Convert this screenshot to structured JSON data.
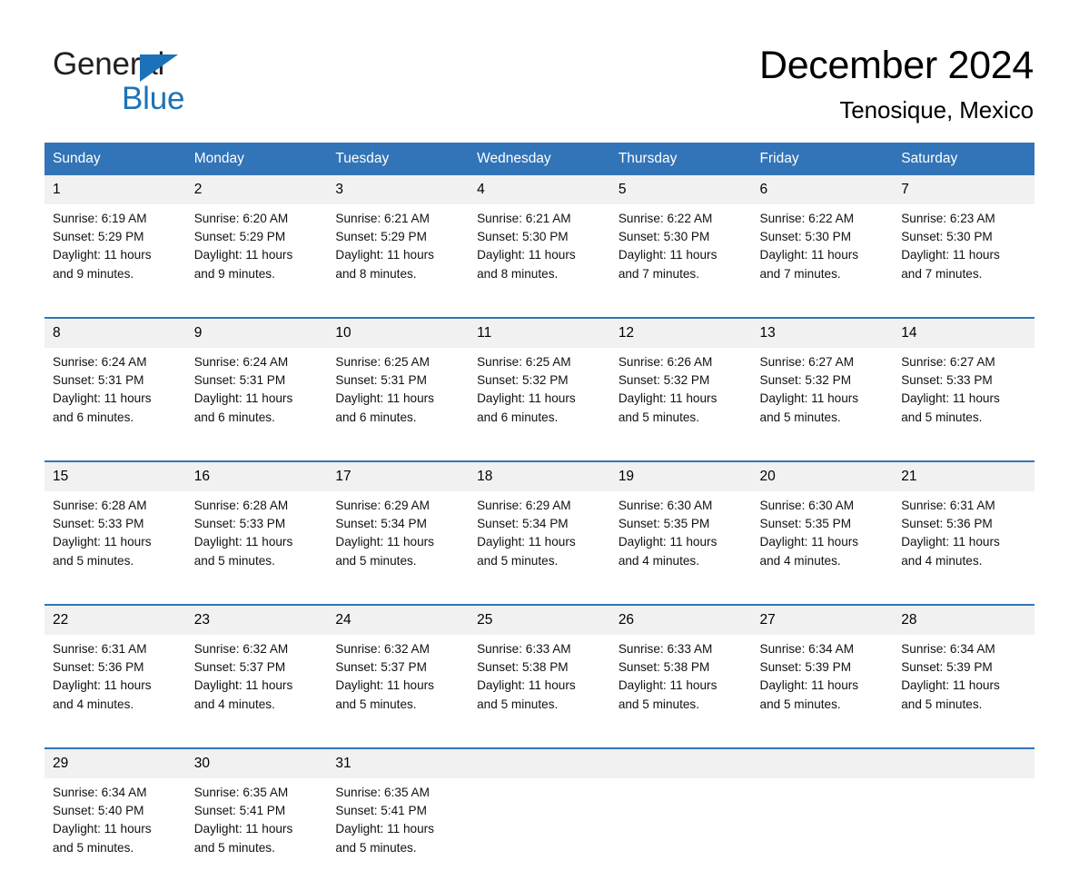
{
  "brand": {
    "name_part1": "General",
    "name_part2": "Blue",
    "logo_icon": "triangle-logo-icon",
    "accent_color": "#1b72b8"
  },
  "header": {
    "title": "December 2024",
    "subtitle": "Tenosique, Mexico"
  },
  "theme": {
    "header_blue": "#3174b8",
    "day_band_gray": "#f1f1f1",
    "rule_blue": "#3174b8",
    "text_black": "#000000"
  },
  "weekday_headers": [
    "Sunday",
    "Monday",
    "Tuesday",
    "Wednesday",
    "Thursday",
    "Friday",
    "Saturday"
  ],
  "weeks": [
    {
      "days": [
        {
          "day": "1",
          "sunrise": "Sunrise: 6:19 AM",
          "sunset": "Sunset: 5:29 PM",
          "daylight_line1": "Daylight: 11 hours",
          "daylight_line2": "and 9 minutes."
        },
        {
          "day": "2",
          "sunrise": "Sunrise: 6:20 AM",
          "sunset": "Sunset: 5:29 PM",
          "daylight_line1": "Daylight: 11 hours",
          "daylight_line2": "and 9 minutes."
        },
        {
          "day": "3",
          "sunrise": "Sunrise: 6:21 AM",
          "sunset": "Sunset: 5:29 PM",
          "daylight_line1": "Daylight: 11 hours",
          "daylight_line2": "and 8 minutes."
        },
        {
          "day": "4",
          "sunrise": "Sunrise: 6:21 AM",
          "sunset": "Sunset: 5:30 PM",
          "daylight_line1": "Daylight: 11 hours",
          "daylight_line2": "and 8 minutes."
        },
        {
          "day": "5",
          "sunrise": "Sunrise: 6:22 AM",
          "sunset": "Sunset: 5:30 PM",
          "daylight_line1": "Daylight: 11 hours",
          "daylight_line2": "and 7 minutes."
        },
        {
          "day": "6",
          "sunrise": "Sunrise: 6:22 AM",
          "sunset": "Sunset: 5:30 PM",
          "daylight_line1": "Daylight: 11 hours",
          "daylight_line2": "and 7 minutes."
        },
        {
          "day": "7",
          "sunrise": "Sunrise: 6:23 AM",
          "sunset": "Sunset: 5:30 PM",
          "daylight_line1": "Daylight: 11 hours",
          "daylight_line2": "and 7 minutes."
        }
      ]
    },
    {
      "days": [
        {
          "day": "8",
          "sunrise": "Sunrise: 6:24 AM",
          "sunset": "Sunset: 5:31 PM",
          "daylight_line1": "Daylight: 11 hours",
          "daylight_line2": "and 6 minutes."
        },
        {
          "day": "9",
          "sunrise": "Sunrise: 6:24 AM",
          "sunset": "Sunset: 5:31 PM",
          "daylight_line1": "Daylight: 11 hours",
          "daylight_line2": "and 6 minutes."
        },
        {
          "day": "10",
          "sunrise": "Sunrise: 6:25 AM",
          "sunset": "Sunset: 5:31 PM",
          "daylight_line1": "Daylight: 11 hours",
          "daylight_line2": "and 6 minutes."
        },
        {
          "day": "11",
          "sunrise": "Sunrise: 6:25 AM",
          "sunset": "Sunset: 5:32 PM",
          "daylight_line1": "Daylight: 11 hours",
          "daylight_line2": "and 6 minutes."
        },
        {
          "day": "12",
          "sunrise": "Sunrise: 6:26 AM",
          "sunset": "Sunset: 5:32 PM",
          "daylight_line1": "Daylight: 11 hours",
          "daylight_line2": "and 5 minutes."
        },
        {
          "day": "13",
          "sunrise": "Sunrise: 6:27 AM",
          "sunset": "Sunset: 5:32 PM",
          "daylight_line1": "Daylight: 11 hours",
          "daylight_line2": "and 5 minutes."
        },
        {
          "day": "14",
          "sunrise": "Sunrise: 6:27 AM",
          "sunset": "Sunset: 5:33 PM",
          "daylight_line1": "Daylight: 11 hours",
          "daylight_line2": "and 5 minutes."
        }
      ]
    },
    {
      "days": [
        {
          "day": "15",
          "sunrise": "Sunrise: 6:28 AM",
          "sunset": "Sunset: 5:33 PM",
          "daylight_line1": "Daylight: 11 hours",
          "daylight_line2": "and 5 minutes."
        },
        {
          "day": "16",
          "sunrise": "Sunrise: 6:28 AM",
          "sunset": "Sunset: 5:33 PM",
          "daylight_line1": "Daylight: 11 hours",
          "daylight_line2": "and 5 minutes."
        },
        {
          "day": "17",
          "sunrise": "Sunrise: 6:29 AM",
          "sunset": "Sunset: 5:34 PM",
          "daylight_line1": "Daylight: 11 hours",
          "daylight_line2": "and 5 minutes."
        },
        {
          "day": "18",
          "sunrise": "Sunrise: 6:29 AM",
          "sunset": "Sunset: 5:34 PM",
          "daylight_line1": "Daylight: 11 hours",
          "daylight_line2": "and 5 minutes."
        },
        {
          "day": "19",
          "sunrise": "Sunrise: 6:30 AM",
          "sunset": "Sunset: 5:35 PM",
          "daylight_line1": "Daylight: 11 hours",
          "daylight_line2": "and 4 minutes."
        },
        {
          "day": "20",
          "sunrise": "Sunrise: 6:30 AM",
          "sunset": "Sunset: 5:35 PM",
          "daylight_line1": "Daylight: 11 hours",
          "daylight_line2": "and 4 minutes."
        },
        {
          "day": "21",
          "sunrise": "Sunrise: 6:31 AM",
          "sunset": "Sunset: 5:36 PM",
          "daylight_line1": "Daylight: 11 hours",
          "daylight_line2": "and 4 minutes."
        }
      ]
    },
    {
      "days": [
        {
          "day": "22",
          "sunrise": "Sunrise: 6:31 AM",
          "sunset": "Sunset: 5:36 PM",
          "daylight_line1": "Daylight: 11 hours",
          "daylight_line2": "and 4 minutes."
        },
        {
          "day": "23",
          "sunrise": "Sunrise: 6:32 AM",
          "sunset": "Sunset: 5:37 PM",
          "daylight_line1": "Daylight: 11 hours",
          "daylight_line2": "and 4 minutes."
        },
        {
          "day": "24",
          "sunrise": "Sunrise: 6:32 AM",
          "sunset": "Sunset: 5:37 PM",
          "daylight_line1": "Daylight: 11 hours",
          "daylight_line2": "and 5 minutes."
        },
        {
          "day": "25",
          "sunrise": "Sunrise: 6:33 AM",
          "sunset": "Sunset: 5:38 PM",
          "daylight_line1": "Daylight: 11 hours",
          "daylight_line2": "and 5 minutes."
        },
        {
          "day": "26",
          "sunrise": "Sunrise: 6:33 AM",
          "sunset": "Sunset: 5:38 PM",
          "daylight_line1": "Daylight: 11 hours",
          "daylight_line2": "and 5 minutes."
        },
        {
          "day": "27",
          "sunrise": "Sunrise: 6:34 AM",
          "sunset": "Sunset: 5:39 PM",
          "daylight_line1": "Daylight: 11 hours",
          "daylight_line2": "and 5 minutes."
        },
        {
          "day": "28",
          "sunrise": "Sunrise: 6:34 AM",
          "sunset": "Sunset: 5:39 PM",
          "daylight_line1": "Daylight: 11 hours",
          "daylight_line2": "and 5 minutes."
        }
      ]
    },
    {
      "days": [
        {
          "day": "29",
          "sunrise": "Sunrise: 6:34 AM",
          "sunset": "Sunset: 5:40 PM",
          "daylight_line1": "Daylight: 11 hours",
          "daylight_line2": "and 5 minutes."
        },
        {
          "day": "30",
          "sunrise": "Sunrise: 6:35 AM",
          "sunset": "Sunset: 5:41 PM",
          "daylight_line1": "Daylight: 11 hours",
          "daylight_line2": "and 5 minutes."
        },
        {
          "day": "31",
          "sunrise": "Sunrise: 6:35 AM",
          "sunset": "Sunset: 5:41 PM",
          "daylight_line1": "Daylight: 11 hours",
          "daylight_line2": "and 5 minutes."
        },
        {
          "day": "",
          "sunrise": "",
          "sunset": "",
          "daylight_line1": "",
          "daylight_line2": ""
        },
        {
          "day": "",
          "sunrise": "",
          "sunset": "",
          "daylight_line1": "",
          "daylight_line2": ""
        },
        {
          "day": "",
          "sunrise": "",
          "sunset": "",
          "daylight_line1": "",
          "daylight_line2": ""
        },
        {
          "day": "",
          "sunrise": "",
          "sunset": "",
          "daylight_line1": "",
          "daylight_line2": ""
        }
      ]
    }
  ]
}
